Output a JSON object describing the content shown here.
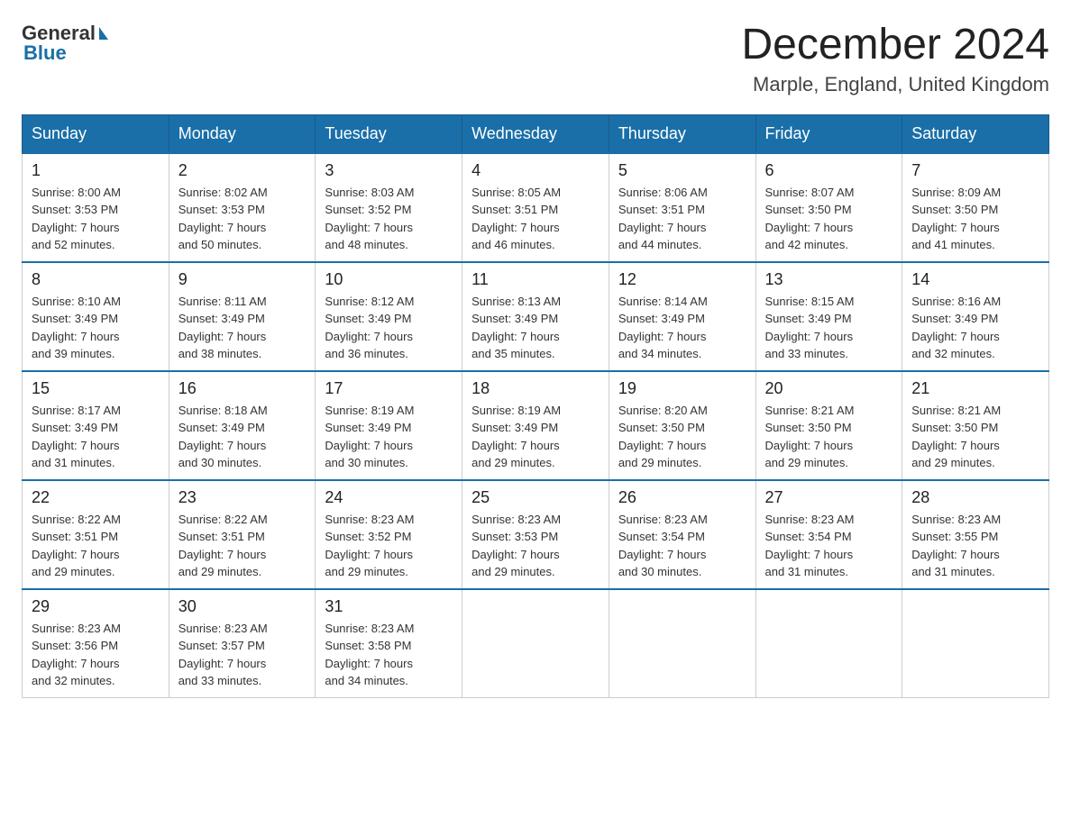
{
  "header": {
    "logo_general": "General",
    "logo_blue": "Blue",
    "month_title": "December 2024",
    "location": "Marple, England, United Kingdom"
  },
  "days_of_week": [
    "Sunday",
    "Monday",
    "Tuesday",
    "Wednesday",
    "Thursday",
    "Friday",
    "Saturday"
  ],
  "weeks": [
    [
      {
        "day": "1",
        "sunrise": "8:00 AM",
        "sunset": "3:53 PM",
        "daylight": "7 hours and 52 minutes."
      },
      {
        "day": "2",
        "sunrise": "8:02 AM",
        "sunset": "3:53 PM",
        "daylight": "7 hours and 50 minutes."
      },
      {
        "day": "3",
        "sunrise": "8:03 AM",
        "sunset": "3:52 PM",
        "daylight": "7 hours and 48 minutes."
      },
      {
        "day": "4",
        "sunrise": "8:05 AM",
        "sunset": "3:51 PM",
        "daylight": "7 hours and 46 minutes."
      },
      {
        "day": "5",
        "sunrise": "8:06 AM",
        "sunset": "3:51 PM",
        "daylight": "7 hours and 44 minutes."
      },
      {
        "day": "6",
        "sunrise": "8:07 AM",
        "sunset": "3:50 PM",
        "daylight": "7 hours and 42 minutes."
      },
      {
        "day": "7",
        "sunrise": "8:09 AM",
        "sunset": "3:50 PM",
        "daylight": "7 hours and 41 minutes."
      }
    ],
    [
      {
        "day": "8",
        "sunrise": "8:10 AM",
        "sunset": "3:49 PM",
        "daylight": "7 hours and 39 minutes."
      },
      {
        "day": "9",
        "sunrise": "8:11 AM",
        "sunset": "3:49 PM",
        "daylight": "7 hours and 38 minutes."
      },
      {
        "day": "10",
        "sunrise": "8:12 AM",
        "sunset": "3:49 PM",
        "daylight": "7 hours and 36 minutes."
      },
      {
        "day": "11",
        "sunrise": "8:13 AM",
        "sunset": "3:49 PM",
        "daylight": "7 hours and 35 minutes."
      },
      {
        "day": "12",
        "sunrise": "8:14 AM",
        "sunset": "3:49 PM",
        "daylight": "7 hours and 34 minutes."
      },
      {
        "day": "13",
        "sunrise": "8:15 AM",
        "sunset": "3:49 PM",
        "daylight": "7 hours and 33 minutes."
      },
      {
        "day": "14",
        "sunrise": "8:16 AM",
        "sunset": "3:49 PM",
        "daylight": "7 hours and 32 minutes."
      }
    ],
    [
      {
        "day": "15",
        "sunrise": "8:17 AM",
        "sunset": "3:49 PM",
        "daylight": "7 hours and 31 minutes."
      },
      {
        "day": "16",
        "sunrise": "8:18 AM",
        "sunset": "3:49 PM",
        "daylight": "7 hours and 30 minutes."
      },
      {
        "day": "17",
        "sunrise": "8:19 AM",
        "sunset": "3:49 PM",
        "daylight": "7 hours and 30 minutes."
      },
      {
        "day": "18",
        "sunrise": "8:19 AM",
        "sunset": "3:49 PM",
        "daylight": "7 hours and 29 minutes."
      },
      {
        "day": "19",
        "sunrise": "8:20 AM",
        "sunset": "3:50 PM",
        "daylight": "7 hours and 29 minutes."
      },
      {
        "day": "20",
        "sunrise": "8:21 AM",
        "sunset": "3:50 PM",
        "daylight": "7 hours and 29 minutes."
      },
      {
        "day": "21",
        "sunrise": "8:21 AM",
        "sunset": "3:50 PM",
        "daylight": "7 hours and 29 minutes."
      }
    ],
    [
      {
        "day": "22",
        "sunrise": "8:22 AM",
        "sunset": "3:51 PM",
        "daylight": "7 hours and 29 minutes."
      },
      {
        "day": "23",
        "sunrise": "8:22 AM",
        "sunset": "3:51 PM",
        "daylight": "7 hours and 29 minutes."
      },
      {
        "day": "24",
        "sunrise": "8:23 AM",
        "sunset": "3:52 PM",
        "daylight": "7 hours and 29 minutes."
      },
      {
        "day": "25",
        "sunrise": "8:23 AM",
        "sunset": "3:53 PM",
        "daylight": "7 hours and 29 minutes."
      },
      {
        "day": "26",
        "sunrise": "8:23 AM",
        "sunset": "3:54 PM",
        "daylight": "7 hours and 30 minutes."
      },
      {
        "day": "27",
        "sunrise": "8:23 AM",
        "sunset": "3:54 PM",
        "daylight": "7 hours and 31 minutes."
      },
      {
        "day": "28",
        "sunrise": "8:23 AM",
        "sunset": "3:55 PM",
        "daylight": "7 hours and 31 minutes."
      }
    ],
    [
      {
        "day": "29",
        "sunrise": "8:23 AM",
        "sunset": "3:56 PM",
        "daylight": "7 hours and 32 minutes."
      },
      {
        "day": "30",
        "sunrise": "8:23 AM",
        "sunset": "3:57 PM",
        "daylight": "7 hours and 33 minutes."
      },
      {
        "day": "31",
        "sunrise": "8:23 AM",
        "sunset": "3:58 PM",
        "daylight": "7 hours and 34 minutes."
      },
      null,
      null,
      null,
      null
    ]
  ],
  "labels": {
    "sunrise": "Sunrise:",
    "sunset": "Sunset:",
    "daylight": "Daylight:"
  }
}
